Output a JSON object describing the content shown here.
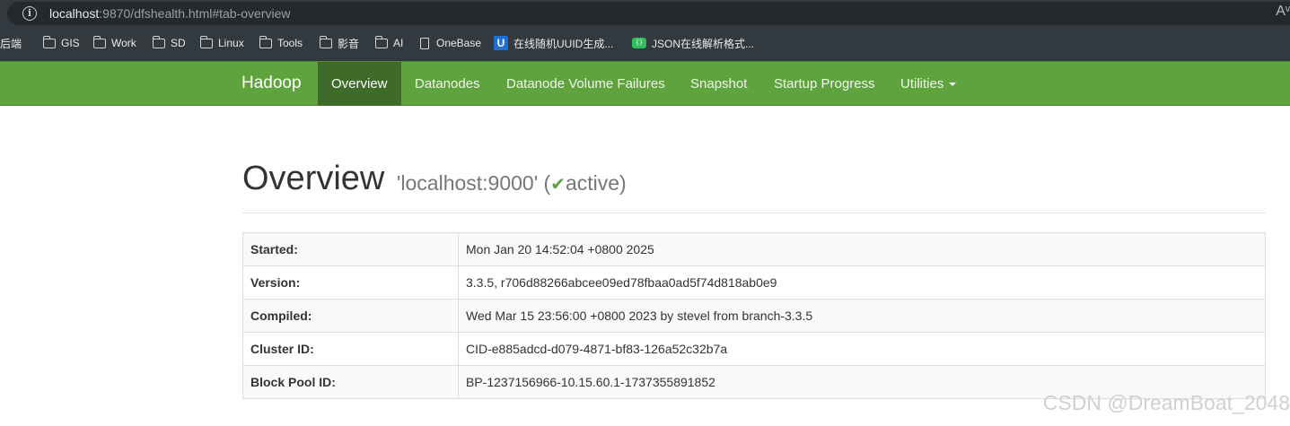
{
  "browser": {
    "url_host": "localhost",
    "url_rest": ":9870/dfshealth.html#tab-overview",
    "reader_label": "Aᵛ",
    "bookmarks": [
      {
        "label": "后端",
        "icon": "folder-icon"
      },
      {
        "label": "GIS",
        "icon": "folder-icon"
      },
      {
        "label": "Work",
        "icon": "folder-icon"
      },
      {
        "label": "SD",
        "icon": "folder-icon"
      },
      {
        "label": "Linux",
        "icon": "folder-icon"
      },
      {
        "label": "Tools",
        "icon": "folder-icon"
      },
      {
        "label": "影音",
        "icon": "folder-icon"
      },
      {
        "label": "AI",
        "icon": "folder-icon"
      },
      {
        "label": "OneBase",
        "icon": "page-icon"
      },
      {
        "label": "在线随机UUID生成...",
        "icon": "uuid-site-icon",
        "glyph": "U"
      },
      {
        "label": "JSON在线解析格式...",
        "icon": "json-site-icon",
        "glyph": "{:}"
      }
    ]
  },
  "navbar": {
    "brand": "Hadoop",
    "items": [
      {
        "label": "Overview",
        "active": true
      },
      {
        "label": "Datanodes"
      },
      {
        "label": "Datanode Volume Failures"
      },
      {
        "label": "Snapshot"
      },
      {
        "label": "Startup Progress"
      },
      {
        "label": "Utilities",
        "dropdown": true
      }
    ],
    "color": "#5fa33e",
    "active_color": "#3e6b29"
  },
  "header": {
    "title": "Overview",
    "address": "'localhost:9000'",
    "paren_open": "(",
    "check_glyph": "✔",
    "state": "active",
    "paren_close": ")"
  },
  "overview_table": [
    {
      "key": "Started:",
      "value": "Mon Jan 20 14:52:04 +0800 2025"
    },
    {
      "key": "Version:",
      "value": "3.3.5, r706d88266abcee09ed78fbaa0ad5f74d818ab0e9"
    },
    {
      "key": "Compiled:",
      "value": "Wed Mar 15 23:56:00 +0800 2023 by stevel from branch-3.3.5"
    },
    {
      "key": "Cluster ID:",
      "value": "CID-e885adcd-d079-4871-bf83-126a52c32b7a"
    },
    {
      "key": "Block Pool ID:",
      "value": "BP-1237156966-10.15.60.1-1737355891852"
    }
  ],
  "watermark": "CSDN @DreamBoat_2048"
}
